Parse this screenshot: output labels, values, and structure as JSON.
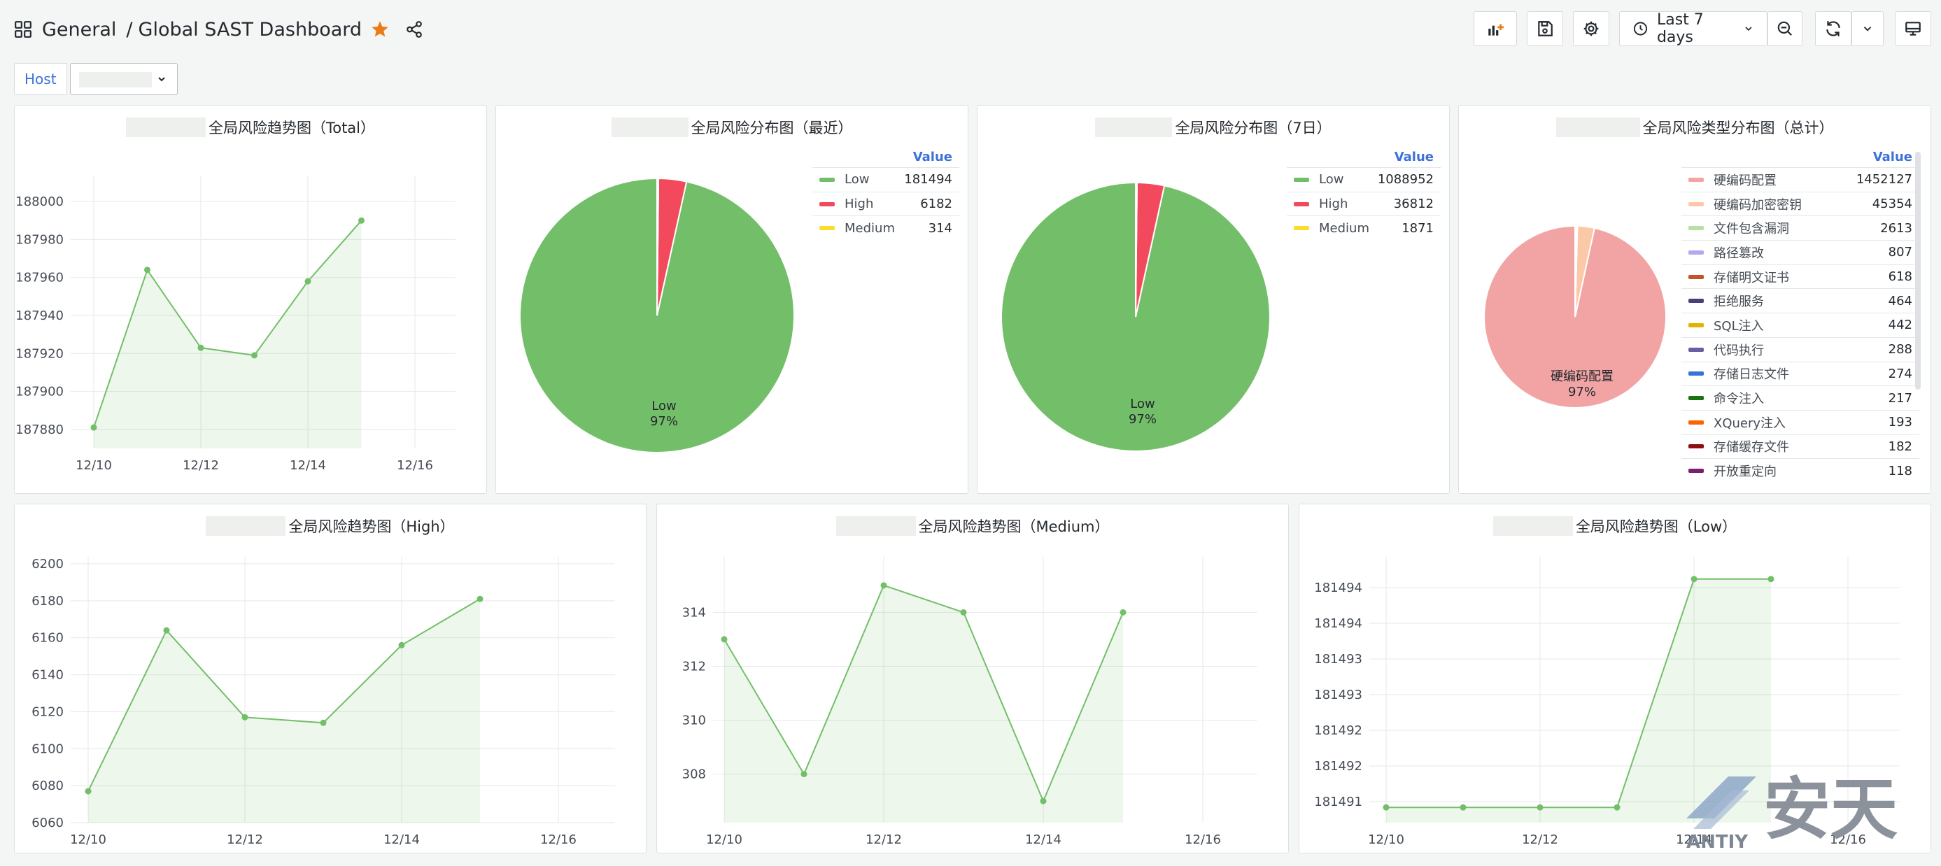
{
  "header": {
    "folder": "General",
    "separator": "/",
    "title": "Global SAST Dashboard",
    "time_range": "Last 7 days"
  },
  "variables": {
    "host_label": "Host"
  },
  "colors": {
    "green": "#73bf69",
    "red": "#f2495c",
    "yellow": "#fade2a",
    "accent": "#3d71d9",
    "star": "#eb7b18"
  },
  "panels": {
    "total": {
      "title": "全局风险趋势图（Total）",
      "chart_data": {
        "type": "line",
        "x": [
          "12/10",
          "12/11",
          "12/12",
          "12/13",
          "12/14",
          "12/15"
        ],
        "values": [
          187881,
          187964,
          187923,
          187919,
          187958,
          187990
        ],
        "yticks": [
          187880,
          187900,
          187920,
          187940,
          187960,
          187980,
          188000
        ],
        "xticks": [
          "12/10",
          "12/12",
          "12/14",
          "12/16"
        ],
        "ylim": [
          187870,
          188010
        ]
      }
    },
    "pie_recent": {
      "title": "全局风险分布图（最近）",
      "value_header": "Value",
      "chart_data": {
        "type": "pie",
        "slices": [
          {
            "name": "Low",
            "value": 181494,
            "color": "#73bf69"
          },
          {
            "name": "High",
            "value": 6182,
            "color": "#f2495c"
          },
          {
            "name": "Medium",
            "value": 314,
            "color": "#fade2a"
          }
        ],
        "label": "Low",
        "label_pct": "97%"
      }
    },
    "pie_7d": {
      "title": "全局风险分布图（7日）",
      "value_header": "Value",
      "chart_data": {
        "type": "pie",
        "slices": [
          {
            "name": "Low",
            "value": 1088952,
            "color": "#73bf69"
          },
          {
            "name": "High",
            "value": 36812,
            "color": "#f2495c"
          },
          {
            "name": "Medium",
            "value": 1871,
            "color": "#fade2a"
          }
        ],
        "label": "Low",
        "label_pct": "97%"
      }
    },
    "pie_types": {
      "title": "全局风险类型分布图（总计）",
      "value_header": "Value",
      "chart_data": {
        "type": "pie",
        "slices": [
          {
            "name": "硬编码配置",
            "value": 1452127,
            "color": "#f2a4a4"
          },
          {
            "name": "硬编码加密密钥",
            "value": 45354,
            "color": "#fcc9a8"
          },
          {
            "name": "文件包含漏洞",
            "value": 2613,
            "color": "#b6e0a6"
          },
          {
            "name": "路径篡改",
            "value": 807,
            "color": "#b7a6f0"
          },
          {
            "name": "存储明文证书",
            "value": 618,
            "color": "#c4522b"
          },
          {
            "name": "拒绝服务",
            "value": 464,
            "color": "#4b3f7a"
          },
          {
            "name": "SQL注入",
            "value": 442,
            "color": "#e0b400"
          },
          {
            "name": "代码执行",
            "value": 288,
            "color": "#6a5fa6"
          },
          {
            "name": "存储日志文件",
            "value": 274,
            "color": "#3274d9"
          },
          {
            "name": "命令注入",
            "value": 217,
            "color": "#1a7311"
          },
          {
            "name": "XQuery注入",
            "value": 193,
            "color": "#fa6400"
          },
          {
            "name": "存储缓存文件",
            "value": 182,
            "color": "#8f0e0e"
          },
          {
            "name": "开放重定向",
            "value": 118,
            "color": "#7a1f6e"
          }
        ],
        "label": "硬编码配置",
        "label_pct": "97%"
      }
    },
    "high": {
      "title": "全局风险趋势图（High）",
      "chart_data": {
        "type": "line",
        "x": [
          "12/10",
          "12/11",
          "12/12",
          "12/13",
          "12/14",
          "12/15"
        ],
        "values": [
          6077,
          6164,
          6117,
          6114,
          6156,
          6181
        ],
        "yticks": [
          6060,
          6080,
          6100,
          6120,
          6140,
          6160,
          6180,
          6200
        ],
        "xticks": [
          "12/10",
          "12/12",
          "12/14",
          "12/16"
        ],
        "ylim": [
          6060,
          6200
        ]
      }
    },
    "medium": {
      "title": "全局风险趋势图（Medium）",
      "chart_data": {
        "type": "line",
        "x": [
          "12/10",
          "12/11",
          "12/12",
          "12/13",
          "12/14",
          "12/15"
        ],
        "values": [
          313,
          308,
          315,
          314,
          307,
          314
        ],
        "yticks": [
          308,
          310,
          312,
          314
        ],
        "xticks": [
          "12/10",
          "12/12",
          "12/14",
          "12/16"
        ],
        "ylim": [
          306.2,
          315.8
        ]
      }
    },
    "low": {
      "title": "全局风险趋势图（Low）",
      "chart_data": {
        "type": "line",
        "x": [
          "12/10",
          "12/11",
          "12/12",
          "12/13",
          "12/14",
          "12/15"
        ],
        "values": [
          181491,
          181491,
          181491,
          181491,
          181494,
          181494
        ],
        "yticks": [
          "181491",
          "181492",
          "181492",
          "181493",
          "181493",
          "181494",
          "181494"
        ],
        "xticks": [
          "12/10",
          "12/12",
          "12/14",
          "12/16"
        ],
        "ylim": [
          181490.8,
          181494.2
        ]
      }
    }
  },
  "watermark": {
    "brand": "安天",
    "latin": "ANTIY"
  }
}
